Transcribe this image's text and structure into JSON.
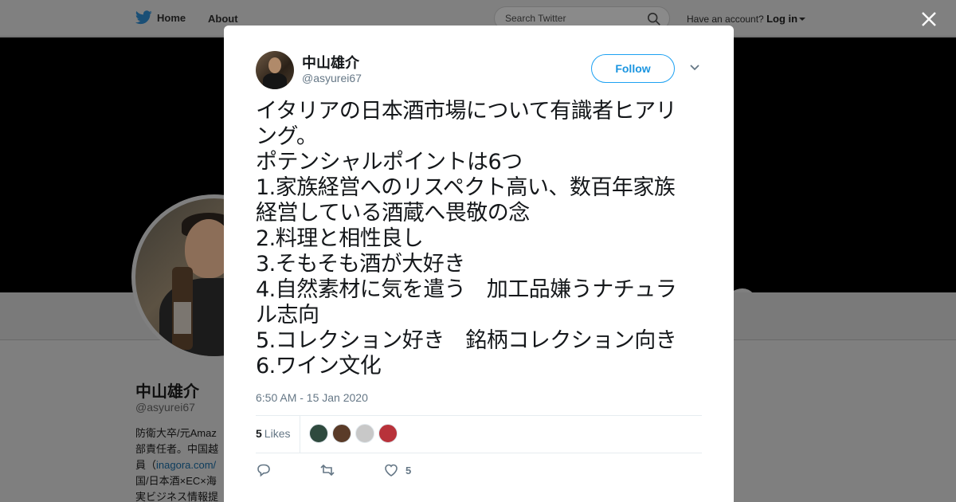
{
  "nav": {
    "home_label": "Home",
    "about_label": "About",
    "search_placeholder": "Search Twitter",
    "account_prompt": "Have an account?",
    "login_label": "Log in"
  },
  "background_profile": {
    "name": "中山雄介",
    "handle": "@asyurei67",
    "bio_lines": [
      "防衛大卒/元Amaz",
      "部責任者。中国越",
      "員（",
      "国/日本酒×EC×海",
      "実ビジネス情報提"
    ],
    "bio_link": "inagora.com/"
  },
  "tweet": {
    "author_name": "中山雄介",
    "author_handle": "@asyurei67",
    "follow_label": "Follow",
    "lines": [
      "イタリアの日本酒市場について有識者ヒアリ",
      "ング。",
      "ポテンシャルポイントは6つ",
      "1.家族経営へのリスペクト高い、数百年家族",
      "経営している酒蔵へ畏敬の念",
      "2.料理と相性良し",
      "3.そもそも酒が大好き",
      "4.自然素材に気を遣う　加工品嫌うナチュラ",
      "ル志向",
      "5.コレクション好き　銘柄コレクション向き",
      "6.ワイン文化"
    ],
    "timestamp": "6:50 AM - 15 Jan 2020",
    "likes_count": "5",
    "likes_label": "Likes",
    "liker_colors": [
      "#2f4a3e",
      "#5a3b28",
      "#c8c8c8",
      "#b8323a"
    ],
    "like_action_count": "5"
  },
  "colors": {
    "accent": "#1da1f2",
    "secondary_text": "#657786"
  }
}
